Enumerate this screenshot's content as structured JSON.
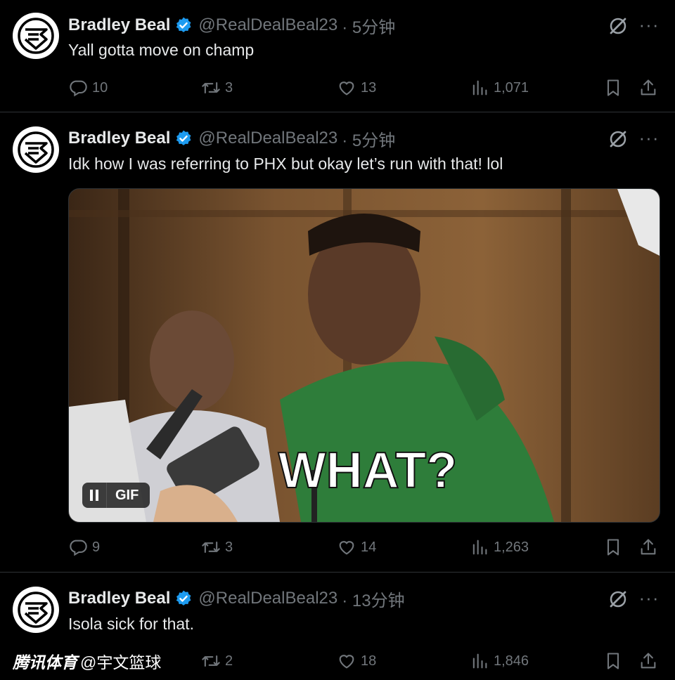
{
  "tweets": [
    {
      "author": "Bradley Beal",
      "handle": "@RealDealBeal23",
      "time": "· 5分钟",
      "text": "Yall gotta move on champ",
      "replies": "10",
      "retweets": "3",
      "likes": "13",
      "views": "1,071"
    },
    {
      "author": "Bradley Beal",
      "handle": "@RealDealBeal23",
      "time": "· 5分钟",
      "text": "Idk how I was referring to PHX but okay let’s run with that! lol",
      "media": {
        "caption": "WHAT?",
        "badge": "GIF"
      },
      "replies": "9",
      "retweets": "3",
      "likes": "14",
      "views": "1,263"
    },
    {
      "author": "Bradley Beal",
      "handle": "@RealDealBeal23",
      "time": "· 13分钟",
      "text": "Isola sick for that.",
      "replies": "",
      "retweets": "2",
      "likes": "18",
      "views": "1,846"
    }
  ],
  "watermark": {
    "brand": "腾讯体育",
    "account": "@宇文篮球"
  },
  "icons": {
    "avatar": "bb-logo-icon",
    "verified": "verified-badge-icon",
    "grok": "grok-icon",
    "more": "more-icon",
    "reply": "reply-icon",
    "retweet": "retweet-icon",
    "like": "heart-icon",
    "views": "views-icon",
    "bookmark": "bookmark-icon",
    "share": "share-icon"
  },
  "colors": {
    "background": "#000000",
    "verified": "#1d9bf0",
    "muted": "#71767b",
    "text": "#e7e9ea"
  }
}
